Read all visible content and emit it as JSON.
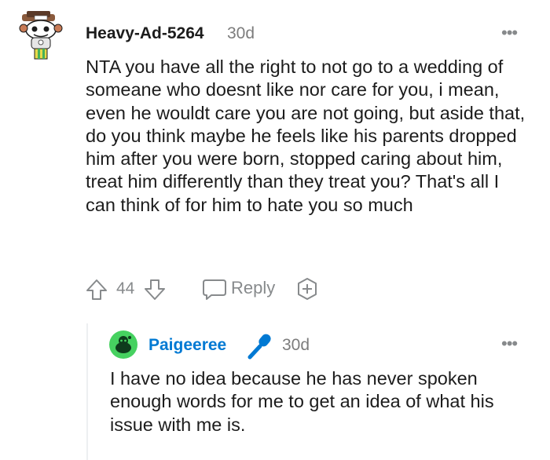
{
  "comment": {
    "username": "Heavy-Ad-5264",
    "time": "30d",
    "more": "•••",
    "body": "NTA you have all the right to not go to a wedding of someane who doesnt like nor care for you, i mean, even he wouldt care you are not going, but aside that, do you think maybe he feels like his parents dropped him after you were born, stopped caring about him, treat him differently than they treat you? That's all I can think of for him to hate you so much",
    "score": "44",
    "reply_label": "Reply"
  },
  "reply": {
    "username": "Paigeeree",
    "time": "30d",
    "more": "•••",
    "body": "I have no idea because he has never spoken enough words for me to get an idea of what his issue with me is."
  },
  "colors": {
    "username_reply": "#0079d3",
    "meta_gray": "#878a8c",
    "mic_blue": "#0079d3",
    "avatar_green": "#46d160"
  },
  "icons": [
    "avatar",
    "upvote-icon",
    "downvote-icon",
    "comment-bubble-icon",
    "award-icon",
    "more-options-icon",
    "microphone-icon"
  ]
}
